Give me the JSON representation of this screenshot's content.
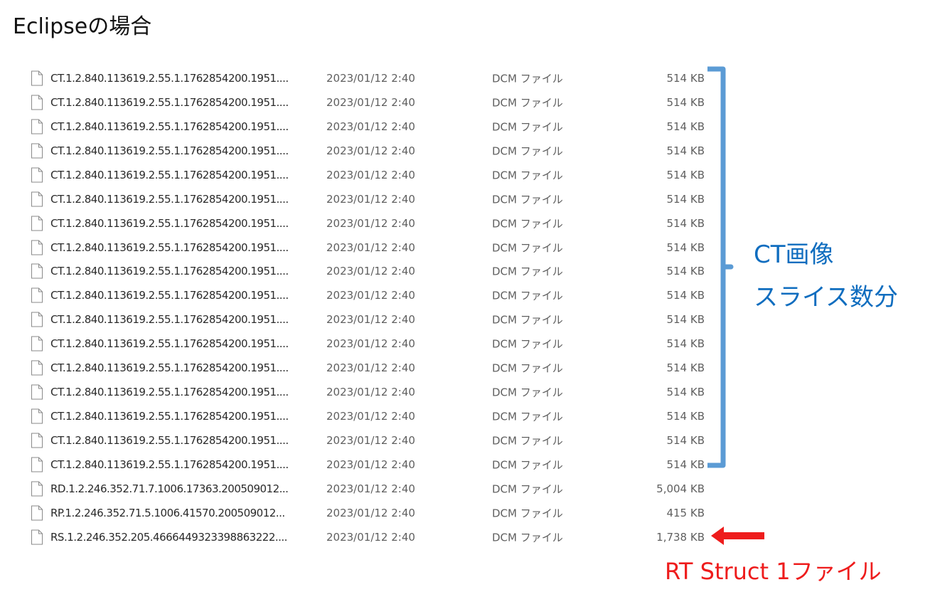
{
  "title": "Eclipseの場合",
  "files": [
    {
      "name": "CT.1.2.840.113619.2.55.1.1762854200.1951....",
      "date": "2023/01/12 2:40",
      "type": "DCM ファイル",
      "size": "514 KB"
    },
    {
      "name": "CT.1.2.840.113619.2.55.1.1762854200.1951....",
      "date": "2023/01/12 2:40",
      "type": "DCM ファイル",
      "size": "514 KB"
    },
    {
      "name": "CT.1.2.840.113619.2.55.1.1762854200.1951....",
      "date": "2023/01/12 2:40",
      "type": "DCM ファイル",
      "size": "514 KB"
    },
    {
      "name": "CT.1.2.840.113619.2.55.1.1762854200.1951....",
      "date": "2023/01/12 2:40",
      "type": "DCM ファイル",
      "size": "514 KB"
    },
    {
      "name": "CT.1.2.840.113619.2.55.1.1762854200.1951....",
      "date": "2023/01/12 2:40",
      "type": "DCM ファイル",
      "size": "514 KB"
    },
    {
      "name": "CT.1.2.840.113619.2.55.1.1762854200.1951....",
      "date": "2023/01/12 2:40",
      "type": "DCM ファイル",
      "size": "514 KB"
    },
    {
      "name": "CT.1.2.840.113619.2.55.1.1762854200.1951....",
      "date": "2023/01/12 2:40",
      "type": "DCM ファイル",
      "size": "514 KB"
    },
    {
      "name": "CT.1.2.840.113619.2.55.1.1762854200.1951....",
      "date": "2023/01/12 2:40",
      "type": "DCM ファイル",
      "size": "514 KB"
    },
    {
      "name": "CT.1.2.840.113619.2.55.1.1762854200.1951....",
      "date": "2023/01/12 2:40",
      "type": "DCM ファイル",
      "size": "514 KB"
    },
    {
      "name": "CT.1.2.840.113619.2.55.1.1762854200.1951....",
      "date": "2023/01/12 2:40",
      "type": "DCM ファイル",
      "size": "514 KB"
    },
    {
      "name": "CT.1.2.840.113619.2.55.1.1762854200.1951....",
      "date": "2023/01/12 2:40",
      "type": "DCM ファイル",
      "size": "514 KB"
    },
    {
      "name": "CT.1.2.840.113619.2.55.1.1762854200.1951....",
      "date": "2023/01/12 2:40",
      "type": "DCM ファイル",
      "size": "514 KB"
    },
    {
      "name": "CT.1.2.840.113619.2.55.1.1762854200.1951....",
      "date": "2023/01/12 2:40",
      "type": "DCM ファイル",
      "size": "514 KB"
    },
    {
      "name": "CT.1.2.840.113619.2.55.1.1762854200.1951....",
      "date": "2023/01/12 2:40",
      "type": "DCM ファイル",
      "size": "514 KB"
    },
    {
      "name": "CT.1.2.840.113619.2.55.1.1762854200.1951....",
      "date": "2023/01/12 2:40",
      "type": "DCM ファイル",
      "size": "514 KB"
    },
    {
      "name": "CT.1.2.840.113619.2.55.1.1762854200.1951....",
      "date": "2023/01/12 2:40",
      "type": "DCM ファイル",
      "size": "514 KB"
    },
    {
      "name": "CT.1.2.840.113619.2.55.1.1762854200.1951....",
      "date": "2023/01/12 2:40",
      "type": "DCM ファイル",
      "size": "514 KB"
    },
    {
      "name": "RD.1.2.246.352.71.7.1006.17363.200509012...",
      "date": "2023/01/12 2:40",
      "type": "DCM ファイル",
      "size": "5,004 KB"
    },
    {
      "name": "RP.1.2.246.352.71.5.1006.41570.200509012...",
      "date": "2023/01/12 2:40",
      "type": "DCM ファイル",
      "size": "415 KB"
    },
    {
      "name": "RS.1.2.246.352.205.4666449323398863222....",
      "date": "2023/01/12 2:40",
      "type": "DCM ファイル",
      "size": "1,738 KB"
    }
  ],
  "annotations": {
    "ct_label_line1": "CT画像",
    "ct_label_line2": "スライス数分",
    "rt_label": "RT Struct 1ファイル"
  },
  "colors": {
    "bracket": "#5b9bd5",
    "ct_label": "#0f6dbf",
    "rt_label": "#ee1c1c",
    "arrow": "#ee1c1c"
  },
  "icons": {
    "file": "file-icon",
    "bracket": "bracket-icon",
    "arrow": "arrow-left-icon"
  }
}
